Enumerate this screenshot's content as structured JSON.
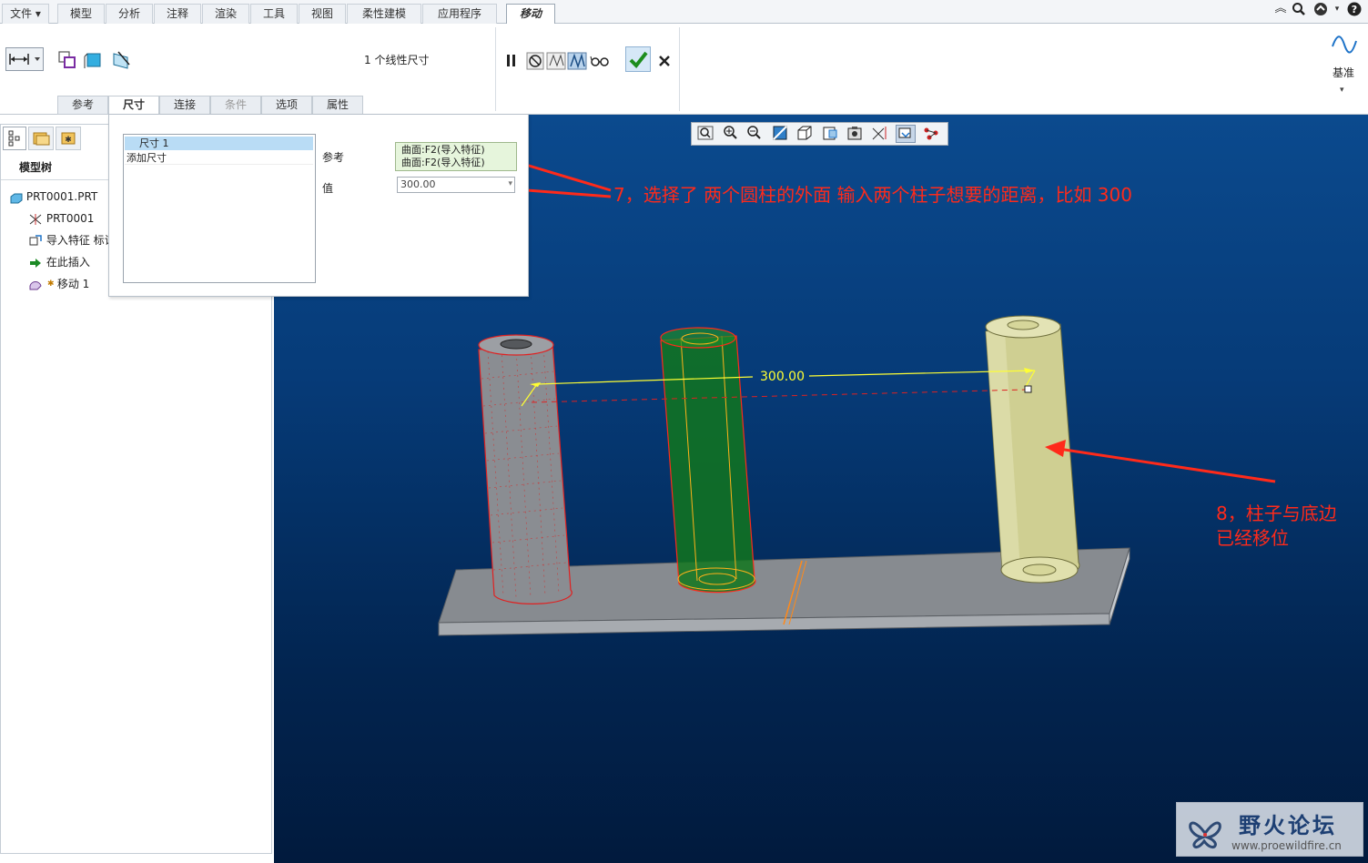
{
  "menubar": {
    "file": "文件",
    "tabs": [
      "模型",
      "分析",
      "注释",
      "渲染",
      "工具",
      "视图",
      "柔性建模",
      "应用程序"
    ],
    "active_tab": "移动"
  },
  "ribbon": {
    "dimension_count_text": "1 个线性尺寸",
    "datum_label": "基准",
    "sub_tabs": [
      "参考",
      "尺寸",
      "连接",
      "条件",
      "选项",
      "属性"
    ]
  },
  "model_tree": {
    "title": "模型树",
    "items": [
      "PRT0001.PRT",
      "PRT0001",
      "导入特征 标记",
      "在此插入",
      "移动 1"
    ]
  },
  "dim_panel": {
    "list_items": [
      "尺寸 1",
      "添加尺寸"
    ],
    "ref_label": "参考",
    "ref_values": [
      "曲面:F2(导入特征)",
      "曲面:F2(导入特征)"
    ],
    "value_label": "值",
    "value": "300.00"
  },
  "viewport": {
    "dimension_text": "300.00"
  },
  "annotations": {
    "note7": "7，选择了  两个圆柱的外面   输入两个柱子想要的距离，比如 300",
    "note8_line1": "8，柱子与底边",
    "note8_line2": "已经移位"
  },
  "watermark": {
    "title": "野火论坛",
    "url": "www.proewildfire.cn"
  },
  "colors": {
    "annotation": "#ff2a1a",
    "viewport_top": "#0b4a8e",
    "viewport_bottom": "#011a3d",
    "cylinder_beige": "#d6d69a",
    "cylinder_green": "#1d8a2a",
    "dimension_yellow": "#ffff33"
  }
}
